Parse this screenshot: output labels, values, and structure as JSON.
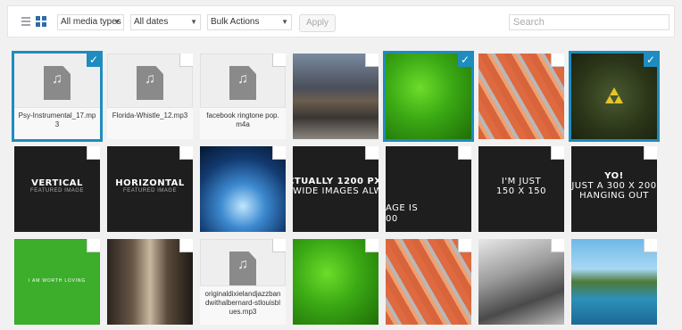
{
  "toolbar": {
    "media_types": "All media types",
    "dates": "All dates",
    "bulk": "Bulk Actions",
    "apply": "Apply",
    "search_placeholder": "Search"
  },
  "colors": {
    "accent": "#1e8cbe"
  },
  "tiles": [
    {
      "type": "audio",
      "name": "Psy-Instrumental_17.mp3",
      "selected": true
    },
    {
      "type": "audio",
      "name": "Florida-Whistle_12.mp3",
      "selected": false
    },
    {
      "type": "audio",
      "name": "facebook ringtone pop.m4a",
      "selected": false
    },
    {
      "type": "image",
      "desc": "city street at dusk",
      "selected": false
    },
    {
      "type": "image",
      "desc": "green leaf with water drops",
      "selected": true
    },
    {
      "type": "image",
      "desc": "salmon fillets on grill",
      "selected": false
    },
    {
      "type": "image",
      "desc": "triforce symbol on green",
      "selected": true
    },
    {
      "type": "text",
      "line1": "VERTICAL",
      "line2": "FEATURED IMAGE",
      "selected": false
    },
    {
      "type": "text",
      "line1": "HORIZONTAL",
      "line2": "FEATURED IMAGE",
      "selected": false
    },
    {
      "type": "image",
      "desc": "unicorn on moon",
      "selected": false
    },
    {
      "type": "text",
      "line1": "CTUALLY 1200 PX W",
      "line2": "WIDE IMAGES ALW",
      "selected": false
    },
    {
      "type": "text",
      "line1": "AGE IS",
      "line2": "00",
      "selected": false
    },
    {
      "type": "text",
      "line1": "I'M JUST",
      "line2": "150 X 150",
      "selected": false
    },
    {
      "type": "text",
      "line1": "YO!",
      "line2": "JUST A 300 X 200",
      "line3": "HANGING OUT",
      "selected": false
    },
    {
      "type": "text",
      "line1": "I AM WORTH LOVING",
      "selected": false
    },
    {
      "type": "image",
      "desc": "city street daytime",
      "selected": false
    },
    {
      "type": "audio",
      "name": "originaldixielandjazzbandwithalbernard-stlouisblues.mp3",
      "selected": false
    },
    {
      "type": "image",
      "desc": "green leaf with water drops",
      "selected": false
    },
    {
      "type": "image",
      "desc": "salmon fillets on grill",
      "selected": false
    },
    {
      "type": "image",
      "desc": "black and white rock",
      "selected": false
    },
    {
      "type": "image",
      "desc": "coastal cliffs and sea",
      "selected": false
    }
  ]
}
